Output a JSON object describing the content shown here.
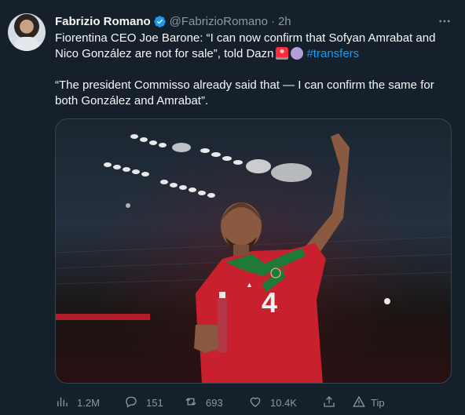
{
  "author": {
    "name": "Fabrizio Romano",
    "handle": "@FabrizioRomano",
    "separator": "·",
    "time": "2h"
  },
  "tweet": {
    "paragraph1": "Fiorentina CEO Joe Barone: “I can now confirm that Sofyan Amrabat and Nico González are not for sale”, told Dazn",
    "hashtag": "#transfers",
    "paragraph2": "“The president Commisso already said that — I can confirm the same for both González and Amrabat”."
  },
  "media": {
    "shirt_number": "4"
  },
  "actions": {
    "views": "1.2M",
    "replies": "151",
    "retweets": "693",
    "likes": "10.4K",
    "tip": "Tip"
  },
  "colors": {
    "background": "#15202b",
    "text": "#f7f9f9",
    "muted": "#8b98a5",
    "link": "#1d9bf0",
    "shirt": "#c8202c"
  },
  "icons": {
    "verified": "verified-badge-icon",
    "more": "more-dots-icon",
    "views": "bar-chart-icon",
    "reply": "speech-bubble-icon",
    "retweet": "retweet-icon",
    "like": "heart-icon",
    "share": "share-upload-icon",
    "tip": "tip-icon"
  }
}
